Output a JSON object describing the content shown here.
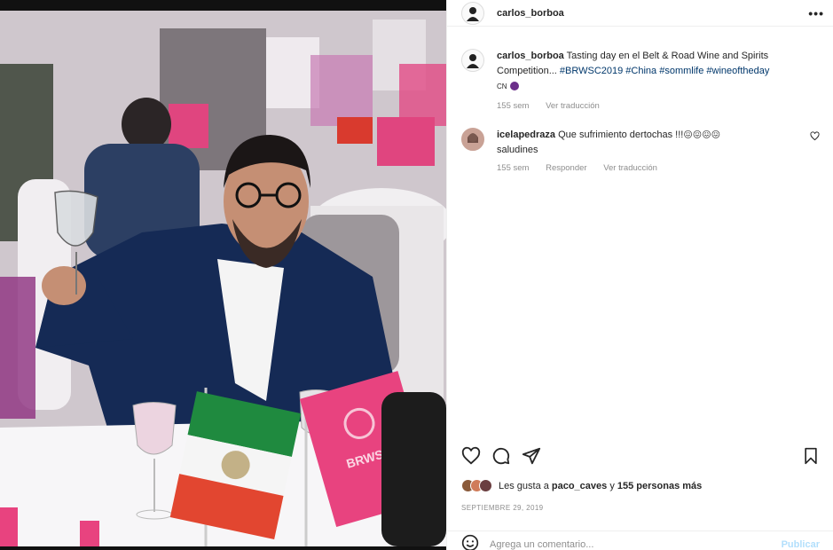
{
  "post": {
    "username": "carlos_borboa",
    "more_label": "•••",
    "caption": {
      "username": "carlos_borboa",
      "text": "Tasting day en el Belt & Road Wine and Spirits Competition... ",
      "hashtags": "#BRWSC2019 #China #sommlife #wineoftheday",
      "suffix": "CN",
      "time": "155 sem",
      "translate": "Ver traducción"
    },
    "comments": [
      {
        "username": "icelapedraza",
        "text": "Que sufrimiento dertochas !!!",
        "emojis": "😖😖😖😖",
        "line2": "saludines",
        "time": "155 sem",
        "reply": "Responder",
        "translate": "Ver traducción"
      }
    ],
    "likes": {
      "prefix": "Les gusta a ",
      "user": "paco_caves",
      "middle": " y ",
      "count": "155 personas más"
    },
    "date": "SEPTIEMBRE 29, 2019",
    "add_comment": {
      "placeholder": "Agrega un comentario...",
      "publish": "Publicar"
    }
  },
  "photo": {
    "flag_right_text": "BRWSC"
  },
  "icons": [
    "more-icon",
    "heart-icon",
    "comment-icon",
    "share-icon",
    "bookmark-icon",
    "emoji-icon"
  ],
  "colors": {
    "tag": "#00376b",
    "meta": "#8e8e8e",
    "publish": "#b2dffc",
    "flag_pink": "#e8437f"
  }
}
